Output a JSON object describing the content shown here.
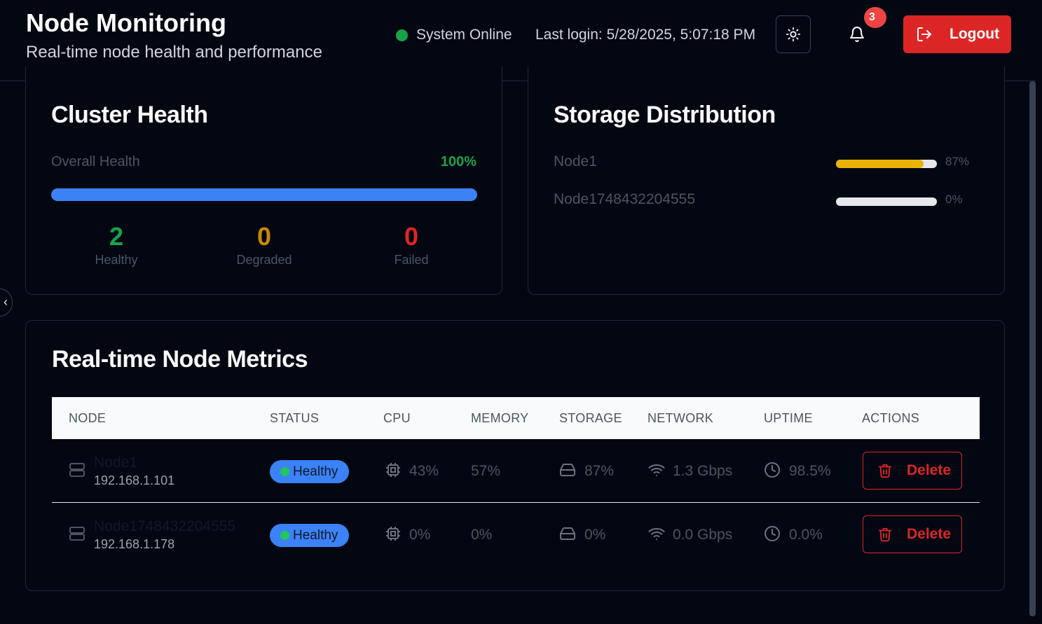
{
  "header": {
    "title": "Node Monitoring",
    "subtitle": "Real-time node health and performance",
    "status_text": "System Online",
    "last_login": "Last login: 5/28/2025, 5:07:18 PM",
    "notification_count": "3",
    "logout_label": "Logout"
  },
  "cluster_health": {
    "title": "Cluster Health",
    "overall_label": "Overall Health",
    "overall_value": "100%",
    "overall_fraction": 1.0,
    "healthy_count": "2",
    "healthy_label": "Healthy",
    "degraded_count": "0",
    "degraded_label": "Degraded",
    "failed_count": "0",
    "failed_label": "Failed"
  },
  "storage": {
    "title": "Storage Distribution",
    "items": [
      {
        "name": "Node1",
        "pct": "87%",
        "fraction": 0.87
      },
      {
        "name": "Node1748432204555",
        "pct": "0%",
        "fraction": 0
      }
    ]
  },
  "metrics": {
    "title": "Real-time Node Metrics",
    "columns": [
      "NODE",
      "STATUS",
      "CPU",
      "MEMORY",
      "STORAGE",
      "NETWORK",
      "UPTIME",
      "ACTIONS"
    ],
    "rows": [
      {
        "name": "Node1",
        "ip": "192.168.1.101",
        "status": "Healthy",
        "cpu": "43%",
        "memory": "57%",
        "storage": "87%",
        "network": "1.3 Gbps",
        "uptime": "98.5%",
        "action": "Delete"
      },
      {
        "name": "Node1748432204555",
        "ip": "192.168.1.178",
        "status": "Healthy",
        "cpu": "0%",
        "memory": "0%",
        "storage": "0%",
        "network": "0.0 Gbps",
        "uptime": "0.0%",
        "action": "Delete"
      }
    ]
  },
  "colors": {
    "accent_blue": "#3b82f6",
    "healthy_green": "#16a34a",
    "degraded_amber": "#ca8a04",
    "failed_red": "#dc2626",
    "storage_yellow": "#eab308"
  }
}
